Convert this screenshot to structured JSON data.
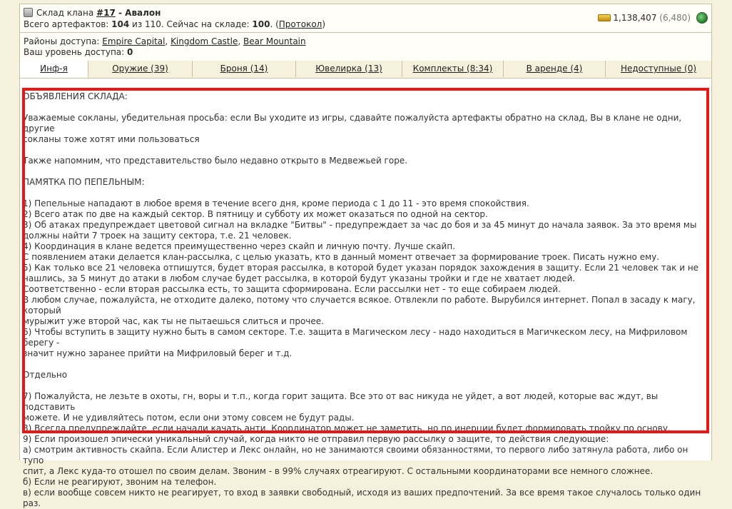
{
  "header": {
    "title_prefix": "Склад клана ",
    "clan_id": "#17",
    "title_sep": " - ",
    "clan_name": "Авалон",
    "total_label": "Всего артефактов: ",
    "total_value": "104",
    "of_text": " из 110. Сейчас на складе: ",
    "now_value": "100",
    "after_now": ". (",
    "protocol_link": "Протокол",
    "close_paren": ")",
    "gold": "1,138,407",
    "gold_extra": "(6,480)"
  },
  "access": {
    "label": "Районы доступа: ",
    "districts": [
      "Empire Capital",
      "Kingdom Castle",
      "Bear Mountain"
    ],
    "sep": ", ",
    "level_label": "Ваш уровень доступа: ",
    "level_value": "0"
  },
  "tabs": [
    {
      "label": "Инф-я"
    },
    {
      "label": "Оружие (39)"
    },
    {
      "label": "Броня (14)"
    },
    {
      "label": "Ювелирка (13)"
    },
    {
      "label": "Комплекты (8:34)"
    },
    {
      "label": "В аренде (4)"
    },
    {
      "label": "Недоступные (0)"
    }
  ],
  "content": {
    "heading": "ОБЪЯВЛЕНИЯ СКЛАДА:",
    "intro": "Уважаемые сокланы, убедительная просьба: если Вы уходите из игры, сдавайте пожалуйста артефакты обратно на склад, Вы в клане не одни, другие\nсокланы тоже хотят ими пользоваться",
    "reminder": "Также напомним, что представительство было недавно открыто в Медвежьей горе.",
    "memo_heading": "ПАМЯТКА ПО ПЕПЕЛЬНЫМ:",
    "memo": "1) Пепельные нападают в любое время в течение всего дня, кроме периода с 1 до 11 - это время спокойствия.\n2) Всего атак по две на каждый сектор. В пятницу и субботу их может оказаться по одной на сектор.\n3) Об атаках предупреждает цветовой сигнал на вкладке \"Битвы\" - предупреждает за час до боя и за 45 минут до начала заявок. За это время мы\nдолжны найти 7 троек на защиту сектора, т.е. 21 человек.\n4) Координация в клане ведется преимущественно через скайп и личную почту. Лучше скайп.\nС появлением атаки делается клан-рассылка, с целью указать, кто в данный момент отвечает за формирование троек. Писать нужно ему.\n5) Как только все 21 человека отпишутся, будет вторая рассылка, в которой будет указан порядок захождения в защиту. Если 21 человек так и не\nнашлись, за 5 минут до атаки в любом случае будет рассылка, в которой будут указаны тройки и где не хватает людей.\nСоответственно - если вторая рассылка есть, то защита сформирована. Если рассылки нет - то еще собираем людей.\nВ любом случае, пожалуйста, не отходите далеко, потому что случается всякое. Отвлекли по работе. Вырубился интернет. Попал в засаду к магу, который\nмурыжит уже второй час, как ты не пытаешься слиться и прочее.\n6) Чтобы вступить в защиту нужно быть в самом секторе. Т.е. защита в Магическом лесу - надо находиться в Магичкеском лесу, на Мифриловом берегу -\nзначит нужно заранее прийти на Мифриловый берег и т.д.",
    "separately": "Отдельно",
    "separate_text": "7) Пожалуйста, не лезьте в охоты, гн, воры и т.п., когда горит защита. Все это от вас никуда не уйдет, а вот людей, которые вас ждут, вы подставить\nможете. И не удивляйтесь потом, если они этому совсем не будут рады.\n8) Всегда предупреждайте, если начали качать анти. Координатор может не заметить, но по инерции будет формировать тройку по основу.\n9) Если произошел эпически уникальный случай, когда никто не отправил первую рассылку о защите, то действия следующие:\na) смотрим активность скайпа. Если Алистер и Лекс онлайн, но не занимаются своими обязанностями, то первого либо затянула работа, либо он тупо\nспит, а Лекс куда-то отошел по своим делам. Звоним - в 99% случаях отреагируют. С остальными координаторами все немного сложнее.\nб) Если не реагируют, звоним на телефон.\nв) если вообще совсем никто не реагирует, то вход в заявки свободный, исходя из ваших предпочтений. За все время такое случалось только один раз."
  },
  "colors": {
    "highlight": "#ea1515",
    "background": "#f5f1dc"
  }
}
